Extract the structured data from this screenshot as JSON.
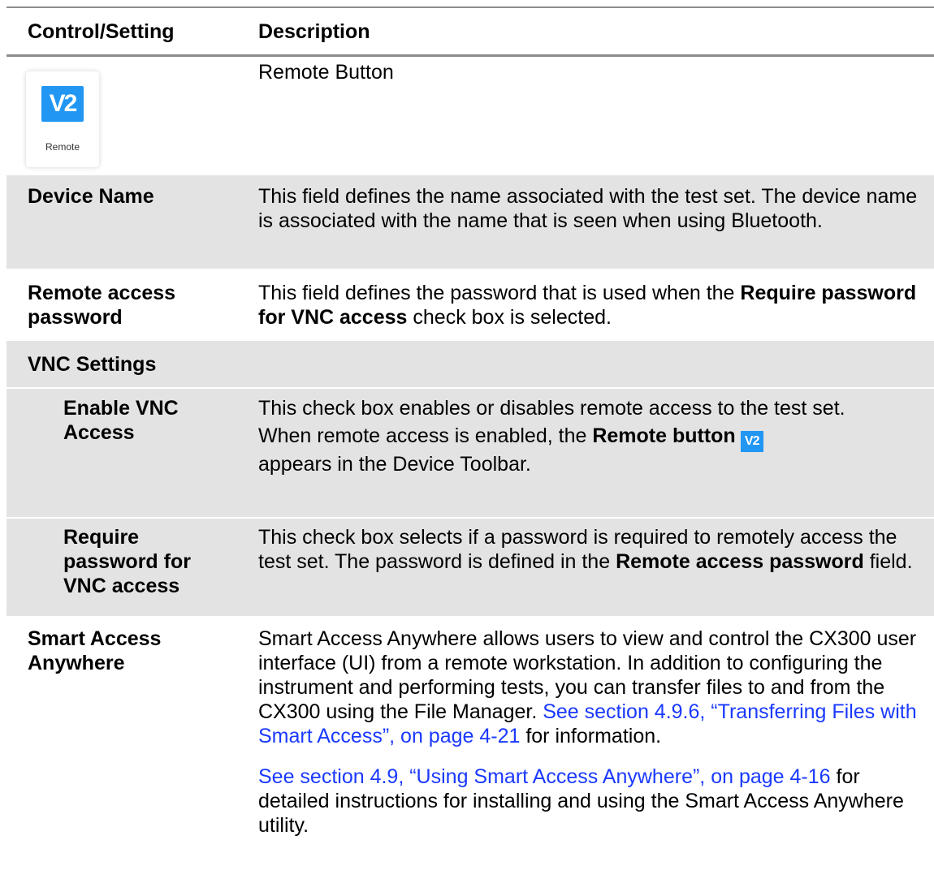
{
  "table": {
    "headers": {
      "control": "Control/Setting",
      "description": "Description"
    },
    "remote_row": {
      "icon_glyph": "V2",
      "icon_label": "Remote",
      "description": "Remote Button"
    },
    "device_name": {
      "label": "Device Name",
      "description": "This field defines the name associated with the test set. The device name is associated with the name that is seen when using Bluetooth."
    },
    "remote_password": {
      "label_line1": "Remote access",
      "label_line2": "password",
      "desc_pre": "This field defines the password that is used when the ",
      "desc_bold": "Require password for VNC access",
      "desc_post": " check box is selected."
    },
    "vnc_settings": {
      "label": "VNC Settings"
    },
    "enable_vnc": {
      "label_line1": "Enable VNC",
      "label_line2": "Access",
      "desc_p1": "This check box enables or disables remote access to the test set.",
      "desc_p2_pre": "When remote access is enabled, the ",
      "desc_p2_bold": "Remote button",
      "desc_p2_icon": "V2",
      "desc_p2_post": "appears in the Device Toolbar."
    },
    "require_password": {
      "label_line1": "Require",
      "label_line2": "password for",
      "label_line3": "VNC access",
      "desc_pre": "This check box selects if a password is required to remotely access the test set. The password is defined in the ",
      "desc_bold": "Remote access password",
      "desc_post": " field."
    },
    "smart_access": {
      "label_line1": "Smart Access",
      "label_line2": "Anywhere",
      "desc_p1_pre": "Smart Access Anywhere allows users to view and control the CX300 user interface (UI) from a remote workstation. In addition to configuring the instrument and performing tests, you can transfer files to and from the CX300 using the File Manager. ",
      "desc_p1_link": "See section 4.9.6, “Transferring Files with Smart Access”, on page 4-21",
      "desc_p1_post": " for information.",
      "desc_p2_link": "See section 4.9, “Using Smart Access Anywhere”, on page 4-16",
      "desc_p2_post": " for detailed instructions for installing and using the Smart Access Anywhere utility."
    }
  },
  "colors": {
    "link": "#1a39ff",
    "row_shade": "#e3e3e3",
    "rule": "#8c8c8c",
    "vnc_icon": "#2196f3"
  }
}
